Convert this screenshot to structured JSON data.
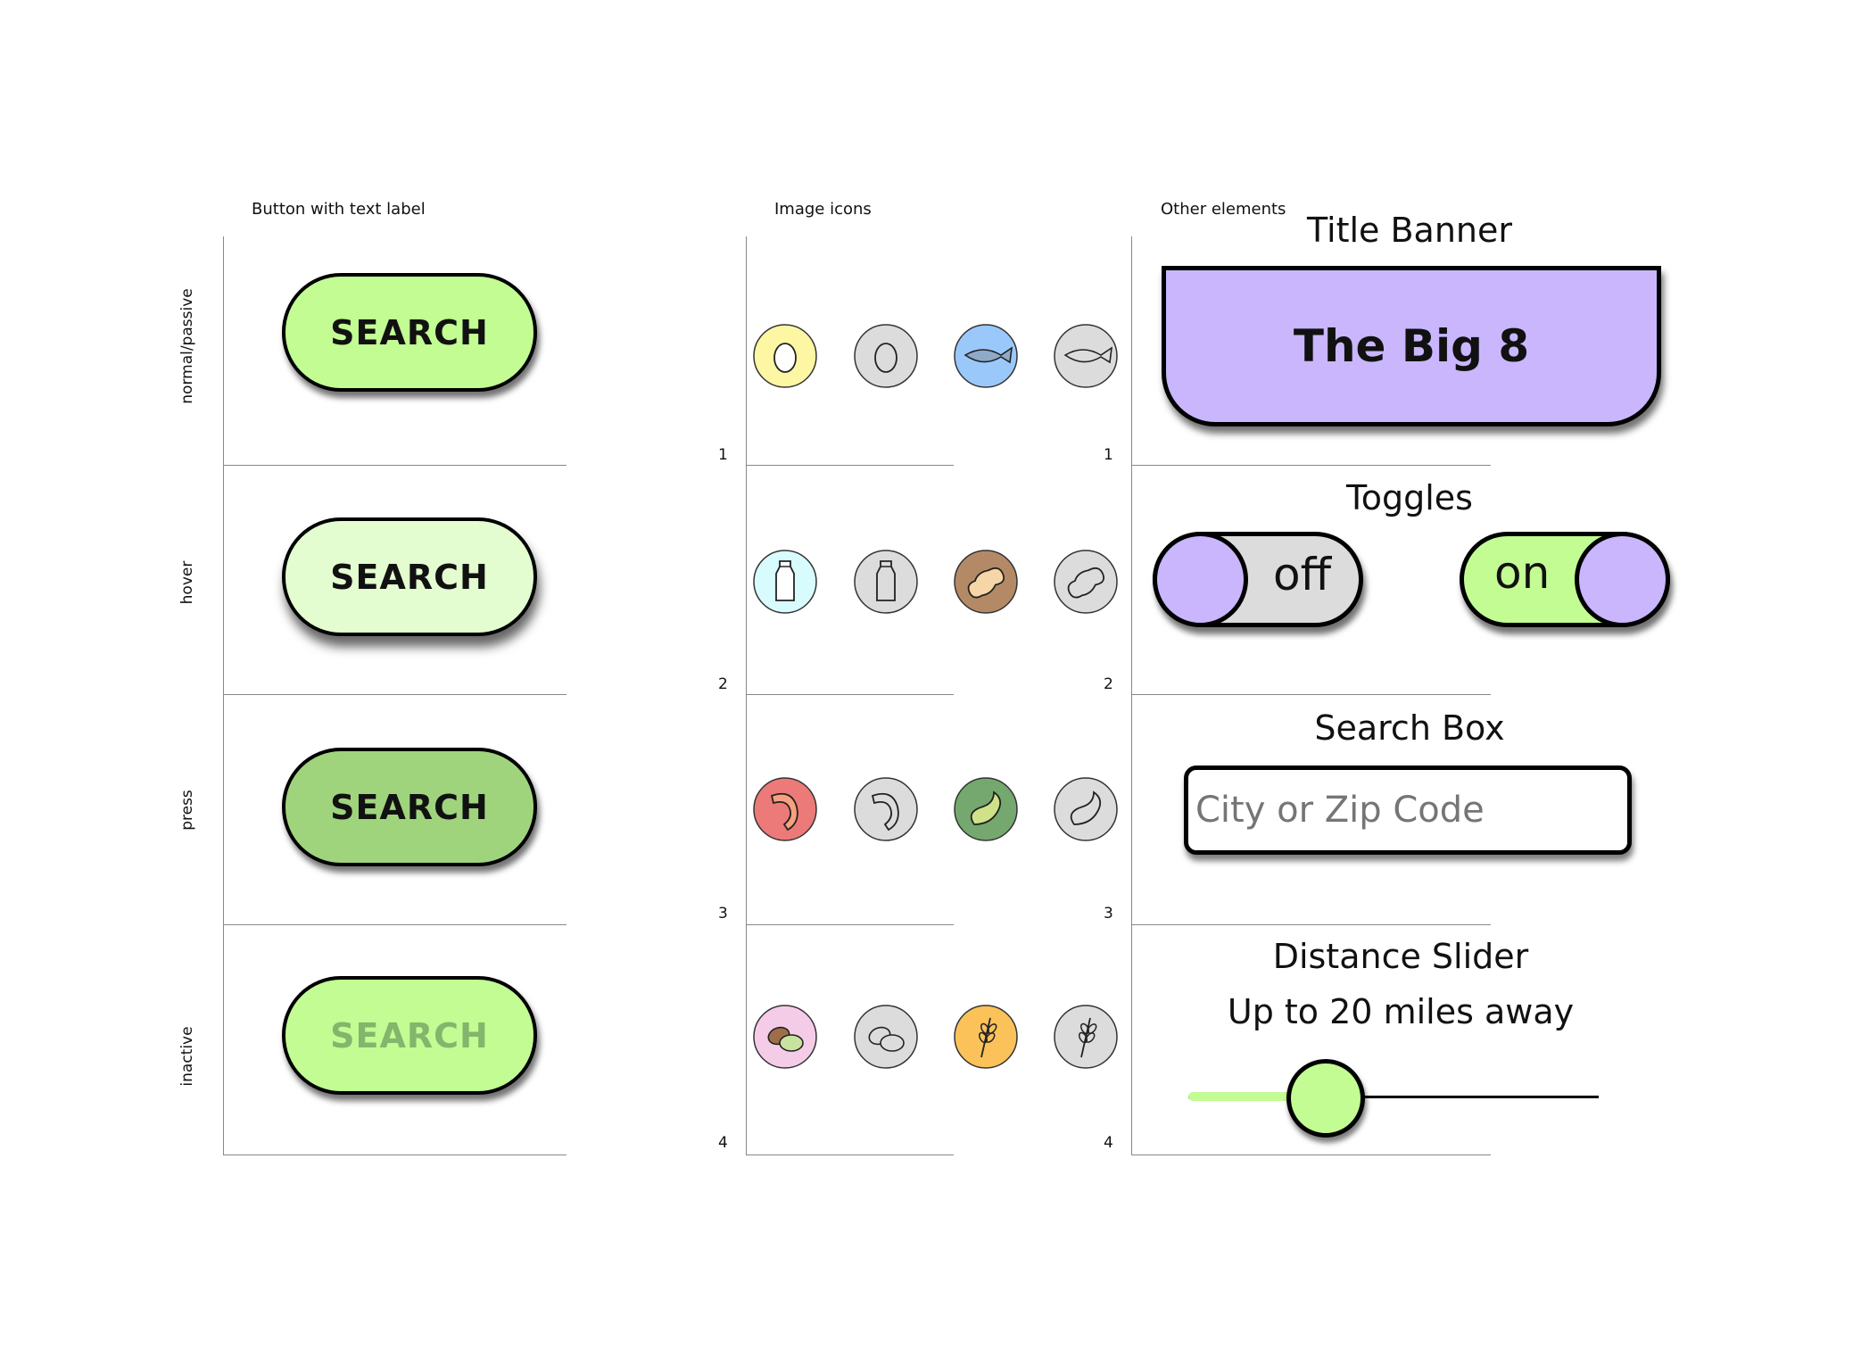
{
  "columns": {
    "buttons": "Button with text label",
    "icons": "Image icons",
    "other": "Other elements"
  },
  "row_labels": [
    "normal/passive",
    "hover",
    "press",
    "inactive"
  ],
  "row_numbers": [
    "1",
    "2",
    "3",
    "4"
  ],
  "search_buttons": [
    {
      "label": "SEARCH",
      "state": "normal",
      "bg": "#c2fc93",
      "text_color": "#111111"
    },
    {
      "label": "SEARCH",
      "state": "hover",
      "bg": "#e3fdd0",
      "text_color": "#111111"
    },
    {
      "label": "SEARCH",
      "state": "press",
      "bg": "#9fd47d",
      "text_color": "#111111"
    },
    {
      "label": "SEARCH",
      "state": "inactive",
      "bg": "#c2fc93",
      "text_color": "#84b56c"
    }
  ],
  "icons": [
    [
      "egg-icon",
      "egg-icon",
      "fish-icon",
      "fish-icon"
    ],
    [
      "milk-icon",
      "milk-icon",
      "peanut-icon",
      "peanut-icon"
    ],
    [
      "shrimp-icon",
      "shrimp-icon",
      "soybean-icon",
      "soybean-icon"
    ],
    [
      "tree-nut-icon",
      "tree-nut-icon",
      "wheat-icon",
      "wheat-icon"
    ]
  ],
  "other": {
    "title_banner_heading": "Title Banner",
    "title_banner_text": "The Big 8",
    "toggles_heading": "Toggles",
    "toggle_off_label": "off",
    "toggle_on_label": "on",
    "search_box_heading": "Search Box",
    "search_placeholder": "City or Zip Code",
    "slider_heading": "Distance Slider",
    "slider_caption": "Up to 20 miles away",
    "slider_value_miles": 20
  },
  "colors": {
    "green": "#c2fc93",
    "purple": "#c9b6fd",
    "gray": "#dcdcdc",
    "egg": "#fdf7a3",
    "fish": "#9ac8fb",
    "milk": "#d8fbfd",
    "peanut": "#b48a66",
    "shrimp": "#ec7a78",
    "soybean": "#75a86f",
    "tree_nut": "#f5cce8",
    "wheat": "#fbc25a"
  }
}
